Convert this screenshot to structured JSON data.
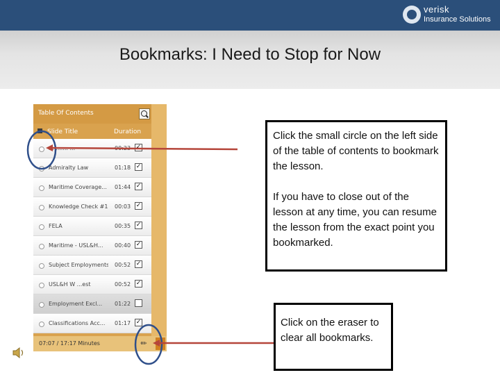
{
  "header": {
    "brand_line1": "verisk",
    "brand_line2": "Insurance Solutions"
  },
  "slide": {
    "title": "Bookmarks: I Need to Stop for Now"
  },
  "toc": {
    "title": "Table Of Contents",
    "columns": {
      "title": "Slide Title",
      "duration": "Duration"
    },
    "rows": [
      {
        "title": "... ....... ...",
        "duration": "00:23",
        "checked": true
      },
      {
        "title": "Admiralty Law",
        "duration": "01:18",
        "checked": true
      },
      {
        "title": "Maritime Coverage...",
        "duration": "01:44",
        "checked": true
      },
      {
        "title": "Knowledge Check #1",
        "duration": "00:03",
        "checked": true
      },
      {
        "title": "FELA",
        "duration": "00:35",
        "checked": true
      },
      {
        "title": "Maritime - USL&H...",
        "duration": "00:40",
        "checked": true
      },
      {
        "title": "Subject Employments",
        "duration": "00:52",
        "checked": true
      },
      {
        "title": "USL&H W ...est",
        "duration": "00:52",
        "checked": true
      },
      {
        "title": "Employment Excl...",
        "duration": "01:22",
        "checked": false,
        "highlight": true
      },
      {
        "title": "Classifications Acc...",
        "duration": "01:17",
        "checked": true
      }
    ],
    "footer_time": "07:07 / 17:17 Minutes",
    "check_glyph": "✓"
  },
  "callouts": {
    "bookmark_p1": "Click the small circle on the left side of the table of contents to bookmark the lesson.",
    "bookmark_p2": "If you have to close out of the lesson at any time, you can resume the lesson from the exact point you bookmarked.",
    "eraser": "Click on the eraser to clear all bookmarks."
  },
  "icons": {
    "search": "search-icon",
    "eraser": "eraser-icon",
    "speaker": "speaker-icon"
  },
  "colors": {
    "topbar": "#2b4f7a",
    "toc_orange": "#d9a24e",
    "arrow_red": "#b5453a",
    "circle_blue": "#2f4f8a"
  }
}
